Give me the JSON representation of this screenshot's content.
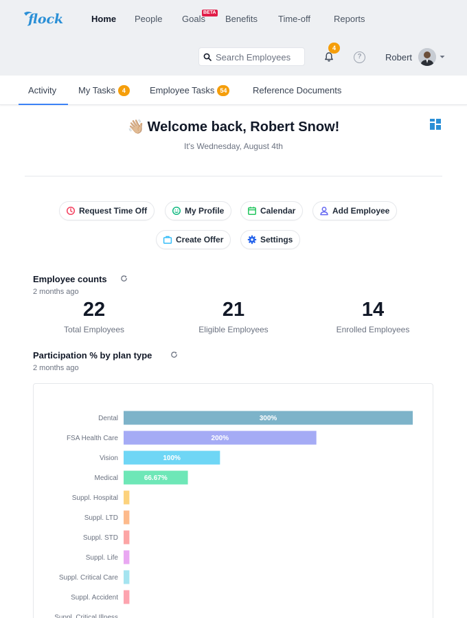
{
  "header": {
    "logo_text": "flock",
    "nav": [
      {
        "label": "Home",
        "active": true
      },
      {
        "label": "People",
        "active": false
      },
      {
        "label": "Goals",
        "active": false,
        "badge": "BETA"
      },
      {
        "label": "Benefits",
        "active": false
      },
      {
        "label": "Time-off",
        "active": false
      },
      {
        "label": "Reports",
        "active": false
      }
    ],
    "search": {
      "placeholder": "Search Employees",
      "value": ""
    },
    "notifications": {
      "count": "4"
    },
    "help_glyph": "?",
    "user": {
      "name": "Robert"
    }
  },
  "tabs": [
    {
      "label": "Activity",
      "active": true,
      "count": ""
    },
    {
      "label": "My Tasks",
      "active": false,
      "count": "4"
    },
    {
      "label": "Employee Tasks",
      "active": false,
      "count": "54"
    },
    {
      "label": "Reference Documents",
      "active": false,
      "count": ""
    }
  ],
  "welcome": {
    "emoji": "👋🏼",
    "title": "Welcome back, Robert Snow!",
    "date": "It's Wednesday, August 4th"
  },
  "quick_actions": [
    {
      "label": "Request Time Off",
      "icon": "clock-icon",
      "color": "#f43f5e"
    },
    {
      "label": "My Profile",
      "icon": "smile-icon",
      "color": "#10b981"
    },
    {
      "label": "Calendar",
      "icon": "calendar-icon",
      "color": "#22c55e"
    },
    {
      "label": "Add Employee",
      "icon": "user-icon",
      "color": "#6366f1"
    },
    {
      "label": "Create Offer",
      "icon": "briefcase-icon",
      "color": "#38bdf8"
    },
    {
      "label": "Settings",
      "icon": "gear-icon",
      "color": "#2563eb"
    }
  ],
  "employee_counts": {
    "title": "Employee counts",
    "updated": "2 months ago",
    "stats": [
      {
        "value": "22",
        "label": "Total Employees"
      },
      {
        "value": "21",
        "label": "Eligible Employees"
      },
      {
        "value": "14",
        "label": "Enrolled Employees"
      }
    ]
  },
  "participation": {
    "title": "Participation % by plan type",
    "updated": "2 months ago"
  },
  "chart_data": {
    "type": "bar",
    "orientation": "horizontal",
    "categories": [
      "Dental",
      "FSA Health Care",
      "Vision",
      "Medical",
      "Suppl. Hospital",
      "Suppl. LTD",
      "Suppl. STD",
      "Suppl. Life",
      "Suppl. Critical Care",
      "Suppl. Accident",
      "Suppl. Critical Illness"
    ],
    "values": [
      300,
      200,
      100,
      66.67,
      6,
      6,
      6,
      6,
      6,
      6,
      0
    ],
    "data_labels": [
      "300%",
      "200%",
      "100%",
      "66.67%",
      "",
      "",
      "",
      "",
      "",
      "",
      ""
    ],
    "colors": [
      "#7db3c9",
      "#a5abf5",
      "#6fd6f5",
      "#6ee7b7",
      "#fcd27d",
      "#fdba8c",
      "#fca5a5",
      "#e9a8f2",
      "#a5e4f0",
      "#fda4af",
      "#d1d5db"
    ],
    "xlim": [
      0,
      300
    ],
    "grid": false,
    "title": "",
    "xlabel": "",
    "ylabel": ""
  },
  "colors": {
    "accent": "#3b82f6",
    "badge": "#f59e0b",
    "brand": "#2a8fd6"
  }
}
